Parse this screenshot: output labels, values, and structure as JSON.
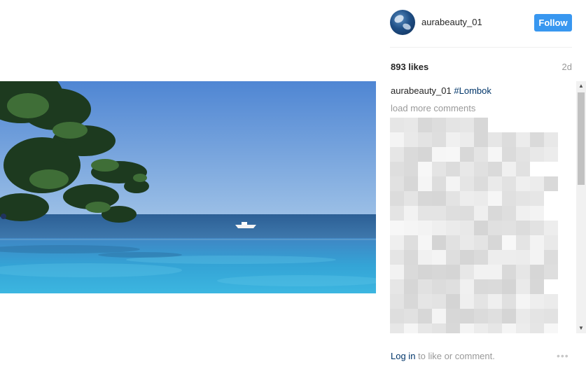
{
  "post": {
    "username": "aurabeauty_01",
    "follow_label": "Follow",
    "likes": "893 likes",
    "age": "2d",
    "caption_author": "aurabeauty_01",
    "caption_tag": "#Lombok",
    "load_more": "load more comments",
    "login_link": "Log in",
    "login_suffix": " to like or comment.",
    "more_options": "•••"
  },
  "colors": {
    "accent": "#3897f0",
    "link": "#003569",
    "muted": "#999999"
  },
  "icons": {
    "scroll_up": "▲",
    "scroll_down": "▼"
  }
}
